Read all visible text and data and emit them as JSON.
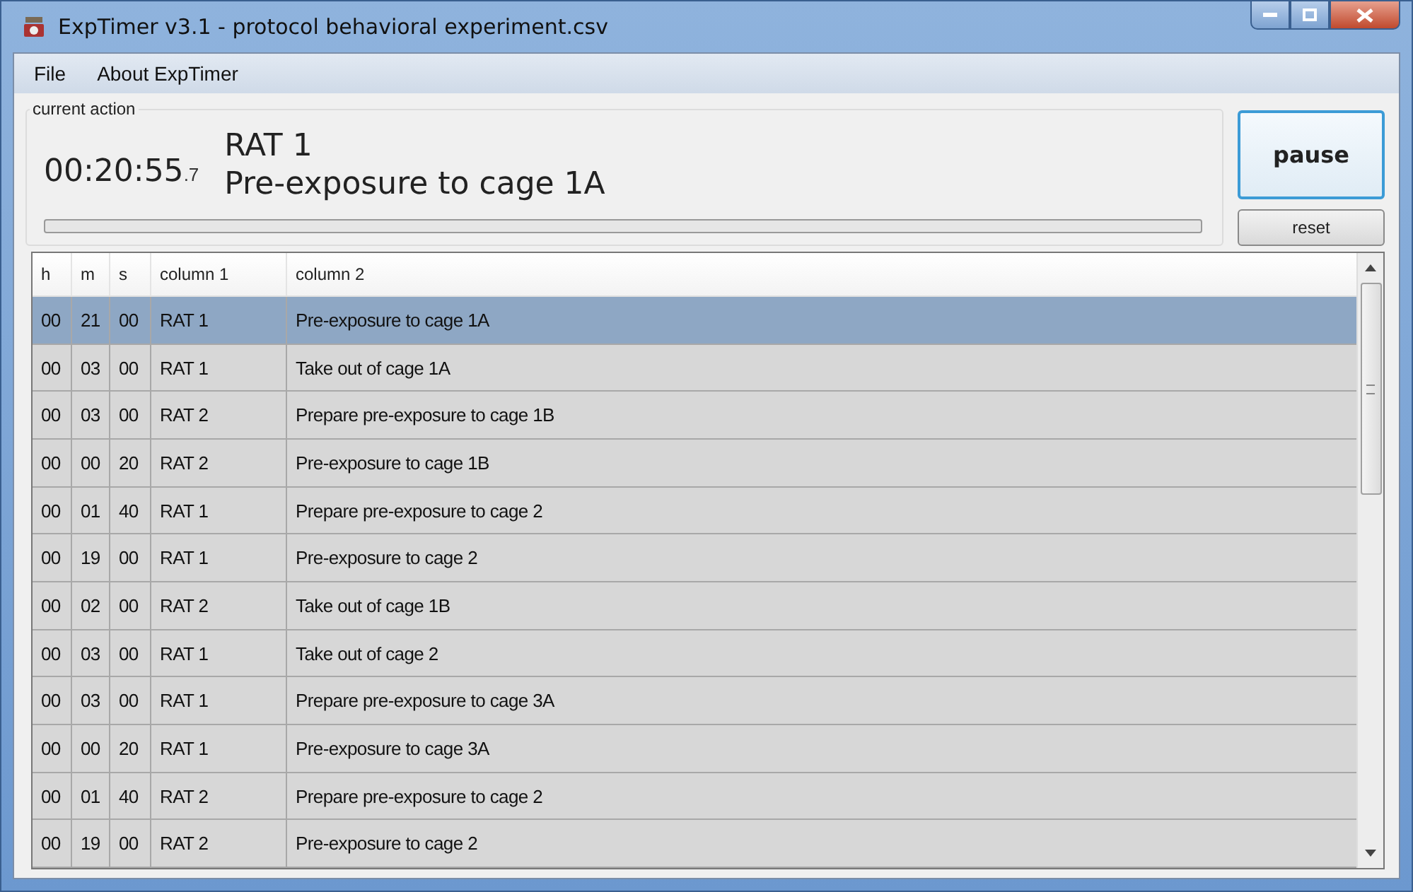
{
  "window": {
    "title": "ExpTimer v3.1 - protocol behavioral experiment.csv"
  },
  "menu": [
    "File",
    "About ExpTimer"
  ],
  "current_action": {
    "label": "current action",
    "time": "00:20:55",
    "tenths": ".7",
    "subject": "RAT 1",
    "action": "Pre-exposure to cage 1A"
  },
  "buttons": {
    "pause": "pause",
    "reset": "reset"
  },
  "table": {
    "columns": [
      "h",
      "m",
      "s",
      "column 1",
      "column 2"
    ],
    "rows": [
      {
        "cells": [
          "00",
          "21",
          "00",
          "RAT 1",
          "Pre-exposure to cage 1A"
        ],
        "selected": true
      },
      {
        "cells": [
          "00",
          "03",
          "00",
          "RAT 1",
          "Take out of cage 1A"
        ],
        "selected": false
      },
      {
        "cells": [
          "00",
          "03",
          "00",
          "RAT 2",
          "Prepare pre-exposure to cage 1B"
        ],
        "selected": false
      },
      {
        "cells": [
          "00",
          "00",
          "20",
          "RAT 2",
          "Pre-exposure to cage 1B"
        ],
        "selected": false
      },
      {
        "cells": [
          "00",
          "01",
          "40",
          "RAT 1",
          "Prepare pre-exposure to cage 2"
        ],
        "selected": false
      },
      {
        "cells": [
          "00",
          "19",
          "00",
          "RAT 1",
          "Pre-exposure to cage 2"
        ],
        "selected": false
      },
      {
        "cells": [
          "00",
          "02",
          "00",
          "RAT 2",
          "Take out of cage 1B"
        ],
        "selected": false
      },
      {
        "cells": [
          "00",
          "03",
          "00",
          "RAT 1",
          "Take out of cage 2"
        ],
        "selected": false
      },
      {
        "cells": [
          "00",
          "03",
          "00",
          "RAT 1",
          "Prepare pre-exposure to cage 3A"
        ],
        "selected": false
      },
      {
        "cells": [
          "00",
          "00",
          "20",
          "RAT 1",
          "Pre-exposure to cage 3A"
        ],
        "selected": false
      },
      {
        "cells": [
          "00",
          "01",
          "40",
          "RAT 2",
          "Prepare pre-exposure to cage 2"
        ],
        "selected": false
      },
      {
        "cells": [
          "00",
          "19",
          "00",
          "RAT 2",
          "Pre-exposure to cage 2"
        ],
        "selected": false
      }
    ]
  }
}
